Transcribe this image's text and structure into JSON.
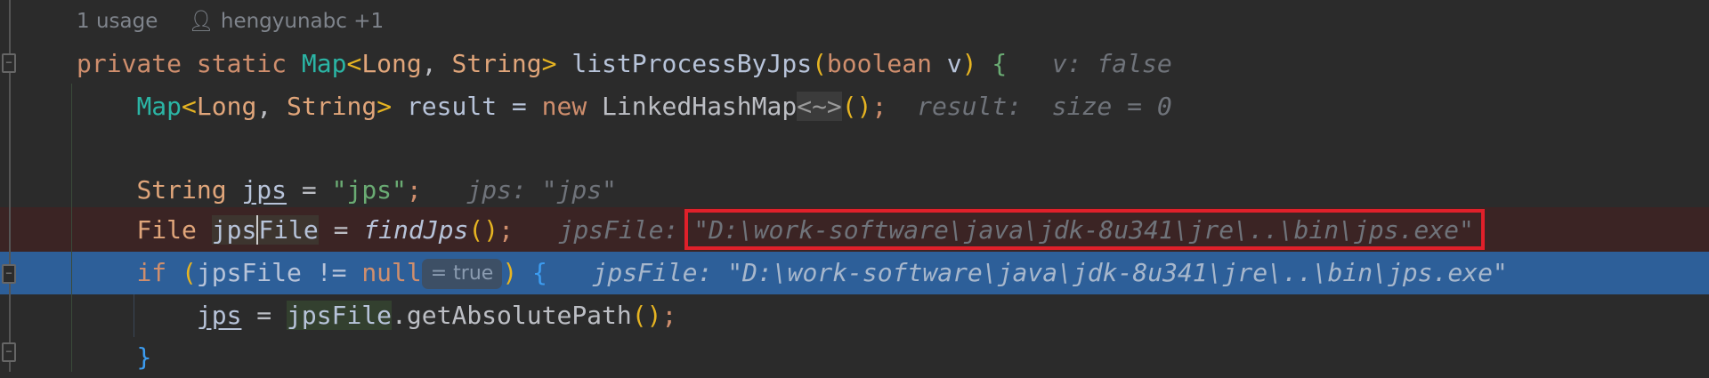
{
  "header": {
    "usages": "1 usage",
    "author": "hengyunabc +1",
    "author_icon": "person-icon"
  },
  "code": {
    "l1": {
      "kw": "private static ",
      "map": "Map",
      "lt": "<",
      "t1": "Long",
      "comma": ", ",
      "t2": "String",
      "gt": ">",
      "sp": " ",
      "name": "listProcessByJps",
      "po": "(",
      "pk": "boolean",
      "pv": " v",
      "pc": ")",
      "b": " {",
      "hint": "v: false"
    },
    "l2": {
      "map": "Map",
      "lt": "<",
      "t1": "Long",
      "comma": ", ",
      "t2": "String",
      "gt": ">",
      "mid": " result = ",
      "new": "new",
      "cls": " LinkedHashMap",
      "diam": "<~>",
      "p": "()",
      "semi": ";",
      "hint": "result:  size = 0"
    },
    "l4": {
      "ty": "String",
      "sp": " ",
      "var": "jps",
      "eq": " = ",
      "str": "\"jps\"",
      "semi": ";",
      "hint": "jps: \"jps\""
    },
    "l5": {
      "ty": "File",
      "sp": " ",
      "v1": "jps",
      "v2": "File",
      "eq": " = ",
      "fn": "findJps",
      "p": "()",
      "semi": ";",
      "hint_label": "jpsFile: ",
      "hint_value": "\"D:\\work-software\\java\\jdk-8u341\\jre\\..\\bin\\jps.exe\""
    },
    "l6": {
      "kw": "if",
      "sp": " ",
      "po": "(",
      "var": "jpsFile != ",
      "null": "null",
      "badge": "= true",
      "pc": ")",
      "b": " {",
      "hint": "jpsFile: \"D:\\work-software\\java\\jdk-8u341\\jre\\..\\bin\\jps.exe\""
    },
    "l7": {
      "var": "jps",
      "eq": " = ",
      "obj": "jpsFile",
      "call": ".getAbsolutePath",
      "p": "()",
      "semi": ";"
    },
    "l8": {
      "b": "}"
    }
  },
  "colors": {
    "highlight_exec_line": "#2d5f99",
    "highlight_error_line": "#3b2424",
    "annotation_box": "#e0202a"
  }
}
